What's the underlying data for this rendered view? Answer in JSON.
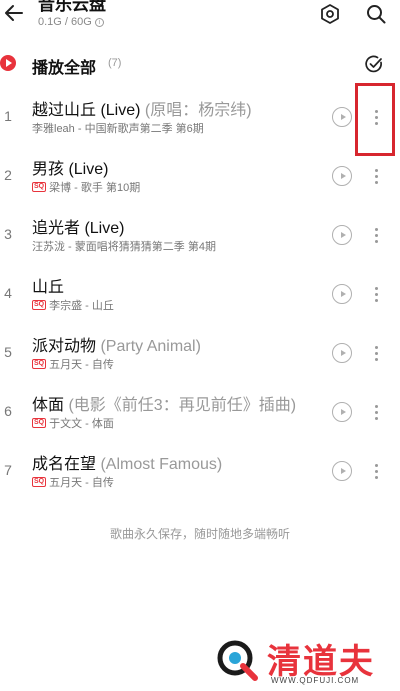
{
  "header": {
    "title": "音乐云盘",
    "storage": "0.1G / 60G",
    "info_glyph": "i",
    "icons": {
      "back": "arrow-left-icon",
      "settings": "gear-hexagon-icon",
      "search": "search-icon"
    }
  },
  "play_all": {
    "label": "播放全部",
    "count": "(7)",
    "icons": {
      "play": "play-circle-icon",
      "multiselect": "check-circle-icon"
    }
  },
  "songs": [
    {
      "index": "1",
      "title": "越过山丘 (Live)",
      "extra": " (原唱：杨宗纬)",
      "sq": "",
      "meta": "李雅leah - 中国新歌声第二季 第6期"
    },
    {
      "index": "2",
      "title": "男孩 (Live)",
      "extra": "",
      "sq": "SQ",
      "meta": "梁博 - 歌手 第10期"
    },
    {
      "index": "3",
      "title": "追光者 (Live)",
      "extra": "",
      "sq": "",
      "meta": "汪苏泷 - 蒙面唱将猜猜猜第二季 第4期"
    },
    {
      "index": "4",
      "title": "山丘",
      "extra": "",
      "sq": "SQ",
      "meta": "李宗盛 - 山丘"
    },
    {
      "index": "5",
      "title": "派对动物",
      "extra": " (Party Animal)",
      "sq": "SQ",
      "meta": "五月天 - 自传"
    },
    {
      "index": "6",
      "title": "体面",
      "extra": " (电影《前任3：再见前任》插曲)",
      "sq": "SQ",
      "meta": "于文文 - 体面"
    },
    {
      "index": "7",
      "title": "成名在望",
      "extra": " (Almost Famous)",
      "sq": "SQ",
      "meta": "五月天 - 自传"
    }
  ],
  "row_icons": {
    "mv": "play-circle-outline-icon",
    "more": "more-vertical-icon"
  },
  "footer_note": "歌曲永久保存，随时随地多端畅听",
  "watermark": {
    "text": "清道夫",
    "url": "WWW.QDFUJI.COM"
  },
  "colors": {
    "accent": "#e8333c",
    "highlight_box": "#d7262e"
  }
}
